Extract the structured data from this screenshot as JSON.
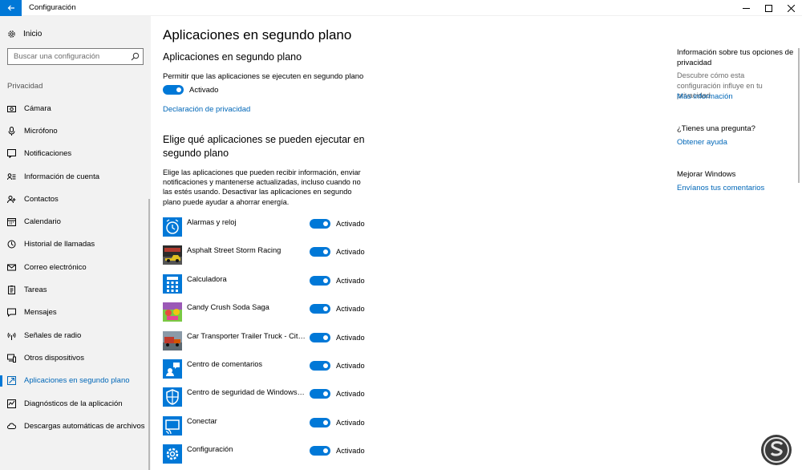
{
  "window": {
    "title": "Configuración"
  },
  "nav": {
    "home": "Inicio",
    "search_placeholder": "Buscar una configuración",
    "section": "Privacidad",
    "items": [
      {
        "label": "Cámara",
        "icon": "camera-icon"
      },
      {
        "label": "Micrófono",
        "icon": "microphone-icon"
      },
      {
        "label": "Notificaciones",
        "icon": "notifications-icon"
      },
      {
        "label": "Información de cuenta",
        "icon": "account-info-icon"
      },
      {
        "label": "Contactos",
        "icon": "contacts-icon"
      },
      {
        "label": "Calendario",
        "icon": "calendar-icon"
      },
      {
        "label": "Historial de llamadas",
        "icon": "call-history-icon"
      },
      {
        "label": "Correo electrónico",
        "icon": "email-icon"
      },
      {
        "label": "Tareas",
        "icon": "tasks-icon"
      },
      {
        "label": "Mensajes",
        "icon": "messages-icon"
      },
      {
        "label": "Señales de radio",
        "icon": "radio-icon"
      },
      {
        "label": "Otros dispositivos",
        "icon": "devices-icon"
      },
      {
        "label": "Aplicaciones en segundo plano",
        "icon": "background-apps-icon",
        "active": true
      },
      {
        "label": "Diagnósticos de la aplicación",
        "icon": "diagnostics-icon"
      },
      {
        "label": "Descargas automáticas de archivos",
        "icon": "cloud-icon"
      }
    ]
  },
  "main": {
    "title": "Aplicaciones en segundo plano",
    "section1_title": "Aplicaciones en segundo plano",
    "permit_label": "Permitir que las aplicaciones se ejecuten en segundo plano",
    "master_toggle_state": "Activado",
    "privacy_link": "Declaración de privacidad",
    "section2_title": "Elige qué aplicaciones se pueden ejecutar en segundo plano",
    "description": "Elige las aplicaciones que pueden recibir información, enviar notificaciones y mantenerse actualizadas, incluso cuando no las estés usando. Desactivar las aplicaciones en segundo plano puede ayudar a ahorrar energía.",
    "apps": [
      {
        "name": "Alarmas y reloj",
        "state": "Activado",
        "icon": "alarm-clock-icon"
      },
      {
        "name": "Asphalt Street Storm Racing",
        "state": "Activado",
        "icon": "asphalt-game-icon"
      },
      {
        "name": "Calculadora",
        "state": "Activado",
        "icon": "calculator-icon"
      },
      {
        "name": "Candy Crush Soda Saga",
        "state": "Activado",
        "icon": "candy-crush-icon"
      },
      {
        "name": "Car Transporter Trailer Truck - City C...",
        "state": "Activado",
        "icon": "truck-game-icon"
      },
      {
        "name": "Centro de comentarios",
        "state": "Activado",
        "icon": "feedback-hub-icon"
      },
      {
        "name": "Centro de seguridad de Windows D...",
        "state": "Activado",
        "icon": "security-shield-icon"
      },
      {
        "name": "Conectar",
        "state": "Activado",
        "icon": "connect-icon"
      },
      {
        "name": "Configuración",
        "state": "Activado",
        "icon": "settings-gear-icon"
      }
    ]
  },
  "aside": {
    "info_title": "Información sobre tus opciones de privacidad",
    "info_text": "Descubre cómo esta configuración influye en tu privacidad.",
    "info_link": "Más información",
    "question_title": "¿Tienes una pregunta?",
    "question_link": "Obtener ayuda",
    "improve_title": "Mejorar Windows",
    "improve_link": "Envíanos tus comentarios"
  },
  "colors": {
    "accent": "#0078d7",
    "link": "#0067b8",
    "nav_bg": "#f2f2f2"
  }
}
